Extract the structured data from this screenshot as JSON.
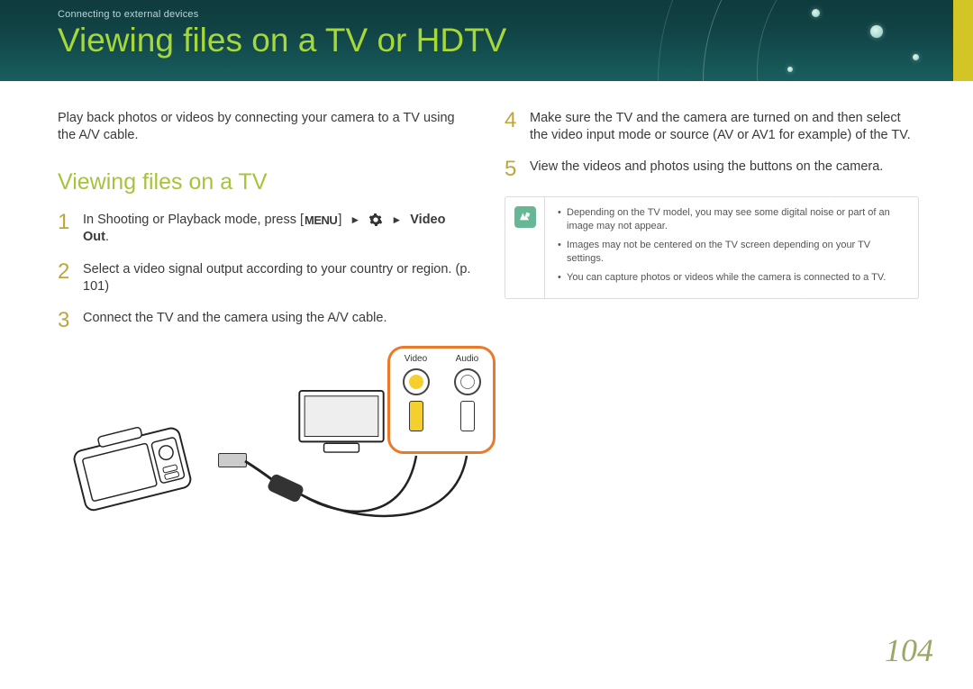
{
  "header": {
    "breadcrumb": "Connecting to external devices",
    "title": "Viewing files on a TV or HDTV"
  },
  "left": {
    "intro": "Play back photos or videos by connecting your camera to a TV using the A/V cable.",
    "subhead": "Viewing files on a TV",
    "steps": {
      "s1_pre": "In Shooting or Playback mode, press [",
      "menu_label": "MENU",
      "s1_mid": "] ",
      "s1_post": "Video Out",
      "s1_end": ".",
      "s2": "Select a video signal output according to your country or region. (p. 101)",
      "s3": "Connect the TV and the camera using the A/V cable."
    },
    "diagram": {
      "video_label": "Video",
      "audio_label": "Audio"
    }
  },
  "right": {
    "steps": {
      "s4": "Make sure the TV and the camera are turned on and then select the video input mode or source (AV or AV1 for example) of the TV.",
      "s5": "View the videos and photos using the buttons on the camera."
    },
    "notes": [
      "Depending on the TV model, you may see some digital noise or part of an image may not appear.",
      "Images may not be centered on the TV screen depending on your TV settings.",
      "You can capture photos or videos while the camera is connected to a TV."
    ]
  },
  "page_number": "104",
  "step_numbers": {
    "n1": "1",
    "n2": "2",
    "n3": "3",
    "n4": "4",
    "n5": "5"
  }
}
